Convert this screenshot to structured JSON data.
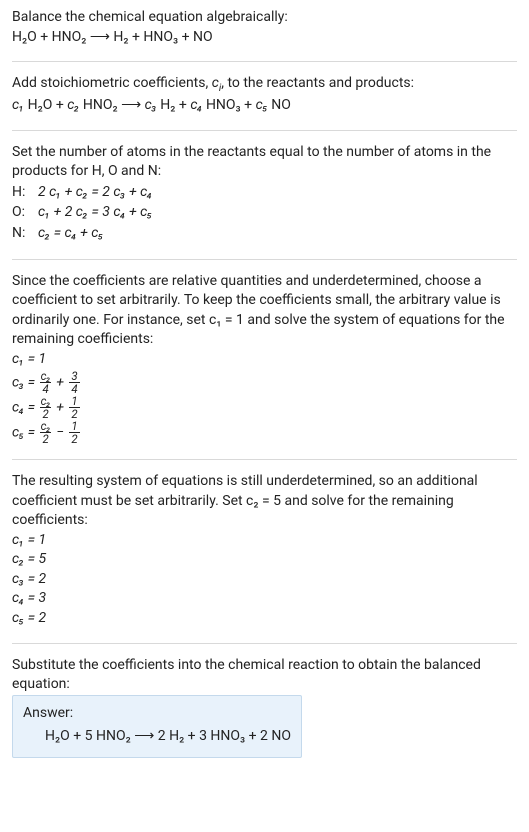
{
  "s1": {
    "intro": "Balance the chemical equation algebraically:",
    "eq": "H₂O + HNO₂  ⟶  H₂ + HNO₃ + NO"
  },
  "s2": {
    "intro_a": "Add stoichiometric coefficients, ",
    "ci": "c",
    "ci_sub": "i",
    "intro_b": ", to the reactants and products:",
    "eq_parts": {
      "c1": "c₁",
      "p1": " H₂O + ",
      "c2": "c₂",
      "p2": " HNO₂  ⟶  ",
      "c3": "c₃",
      "p3": " H₂ + ",
      "c4": "c₄",
      "p4": " HNO₃ + ",
      "c5": "c₅",
      "p5": " NO"
    }
  },
  "s3": {
    "intro": "Set the number of atoms in the reactants equal to the number of atoms in the products for H, O and N:",
    "rows": {
      "h_lbl": "H:",
      "h_eq": "2 c₁ + c₂ = 2 c₃ + c₄",
      "o_lbl": "O:",
      "o_eq": "c₁ + 2 c₂ = 3 c₄ + c₅",
      "n_lbl": "N:",
      "n_eq": "c₂ = c₄ + c₅"
    }
  },
  "s4": {
    "intro": "Since the coefficients are relative quantities and underdetermined, choose a coefficient to set arbitrarily. To keep the coefficients small, the arbitrary value is ordinarily one. For instance, set c₁ = 1 and solve the system of equations for the remaining coefficients:",
    "c1": "c₁ = 1",
    "c3_lhs": "c₃ = ",
    "c3_num1": "c₂",
    "c3_den1": "4",
    "c3_plus": " + ",
    "c3_num2": "3",
    "c3_den2": "4",
    "c4_lhs": "c₄ = ",
    "c4_num1": "c₂",
    "c4_den1": "2",
    "c4_plus": " + ",
    "c4_num2": "1",
    "c4_den2": "2",
    "c5_lhs": "c₅ = ",
    "c5_num1": "c₂",
    "c5_den1": "2",
    "c5_minus": " − ",
    "c5_num2": "1",
    "c5_den2": "2"
  },
  "s5": {
    "intro": "The resulting system of equations is still underdetermined, so an additional coefficient must be set arbitrarily. Set c₂ = 5 and solve for the remaining coefficients:",
    "c1": "c₁ = 1",
    "c2": "c₂ = 5",
    "c3": "c₃ = 2",
    "c4": "c₄ = 3",
    "c5": "c₅ = 2"
  },
  "s6": {
    "intro": "Substitute the coefficients into the chemical reaction to obtain the balanced equation:",
    "answer_title": "Answer:",
    "answer_eq": "H₂O + 5 HNO₂  ⟶  2 H₂ + 3 HNO₃ + 2 NO"
  }
}
